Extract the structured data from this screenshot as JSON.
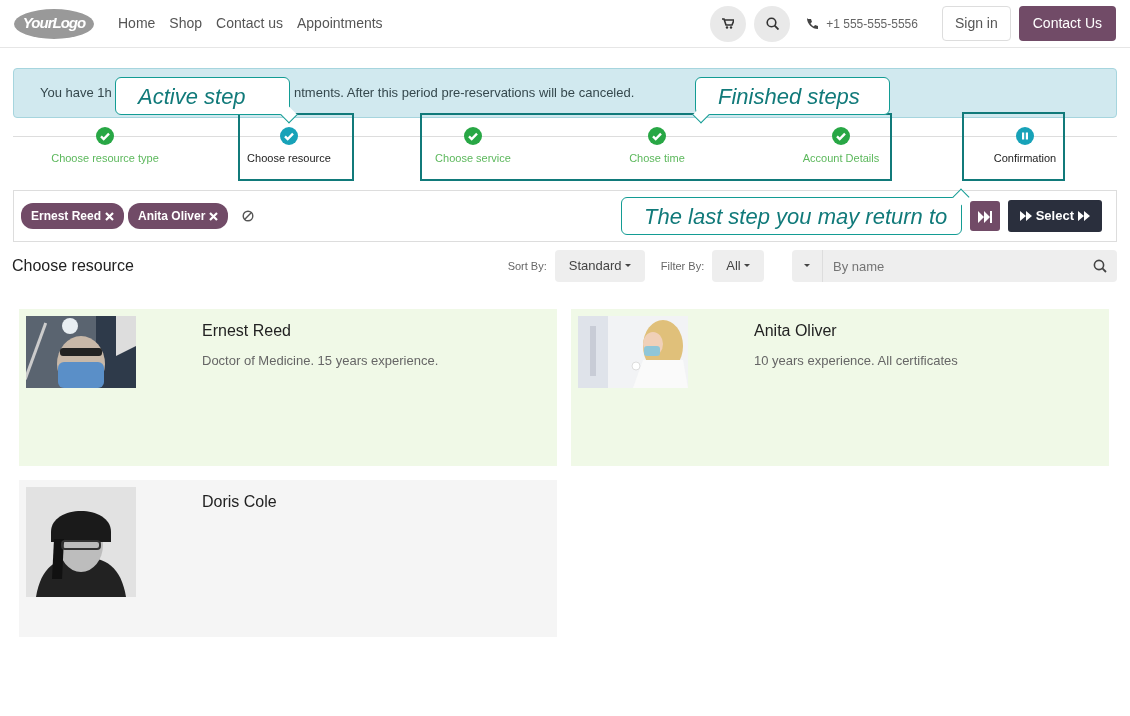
{
  "navbar": {
    "logo": "YourLogo",
    "links": [
      "Home",
      "Shop",
      "Contact us",
      "Appointments"
    ],
    "phone": "+1 555-555-5556",
    "sign_in": "Sign in",
    "contact_button": "Contact Us"
  },
  "alert": {
    "text_start": "You have 1h",
    "text_end": "ntments. After this period pre-reservations will be canceled."
  },
  "steps": [
    {
      "label": "Choose resource type",
      "kind": "done"
    },
    {
      "label": "Choose resource",
      "kind": "active"
    },
    {
      "label": "Choose service",
      "kind": "done"
    },
    {
      "label": "Chose time",
      "kind": "done"
    },
    {
      "label": "Account Details",
      "kind": "done"
    },
    {
      "label": "Confirmation",
      "kind": "paused"
    }
  ],
  "selected_tags": [
    {
      "label": "Ernest Reed"
    },
    {
      "label": "Anita Oliver"
    }
  ],
  "select_button": "Select",
  "section_title": "Choose resource",
  "sort": {
    "label": "Sort By:",
    "value": "Standard"
  },
  "filter": {
    "label": "Filter By:",
    "value": "All"
  },
  "search": {
    "placeholder": "By name"
  },
  "resources": [
    {
      "name": "Ernest Reed",
      "description": "Doctor of Medicine. 15 years experience.",
      "selected": true
    },
    {
      "name": "Anita Oliver",
      "description": "10 years experience. All certificates",
      "selected": true
    },
    {
      "name": "Doris Cole",
      "selected": false
    }
  ],
  "annotations": [
    "Active step",
    "Finished steps",
    "The last step you may return to"
  ]
}
